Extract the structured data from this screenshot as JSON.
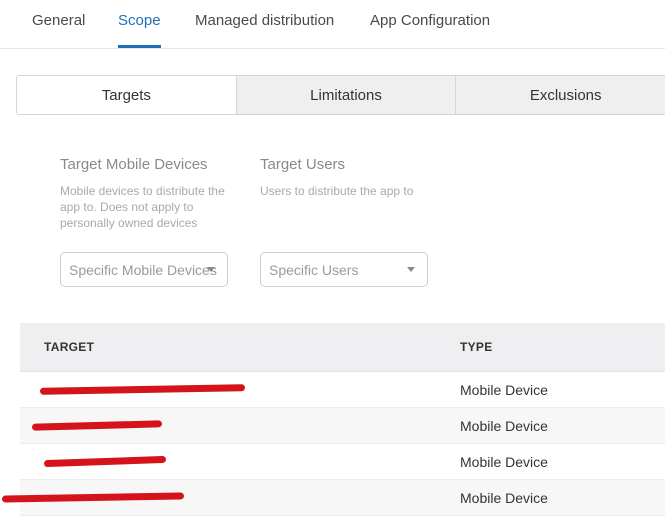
{
  "tabs": [
    {
      "label": "General"
    },
    {
      "label": "Scope"
    },
    {
      "label": "Managed distribution"
    },
    {
      "label": "App Configuration"
    }
  ],
  "segments": [
    {
      "label": "Targets"
    },
    {
      "label": "Limitations"
    },
    {
      "label": "Exclusions"
    }
  ],
  "mobile_devices": {
    "title": "Target Mobile Devices",
    "description": "Mobile devices to distribute the app to. Does not apply to personally owned devices",
    "select_value": "Specific Mobile Devices"
  },
  "users": {
    "title": "Target Users",
    "description": "Users to distribute the app to",
    "select_value": "Specific Users"
  },
  "table": {
    "headers": {
      "target": "TARGET",
      "type": "TYPE"
    },
    "rows": [
      {
        "type": "Mobile Device"
      },
      {
        "type": "Mobile Device"
      },
      {
        "type": "Mobile Device"
      },
      {
        "type": "Mobile Device"
      }
    ]
  },
  "colors": {
    "accent": "#1f6fb5",
    "redaction": "#d4141a"
  }
}
